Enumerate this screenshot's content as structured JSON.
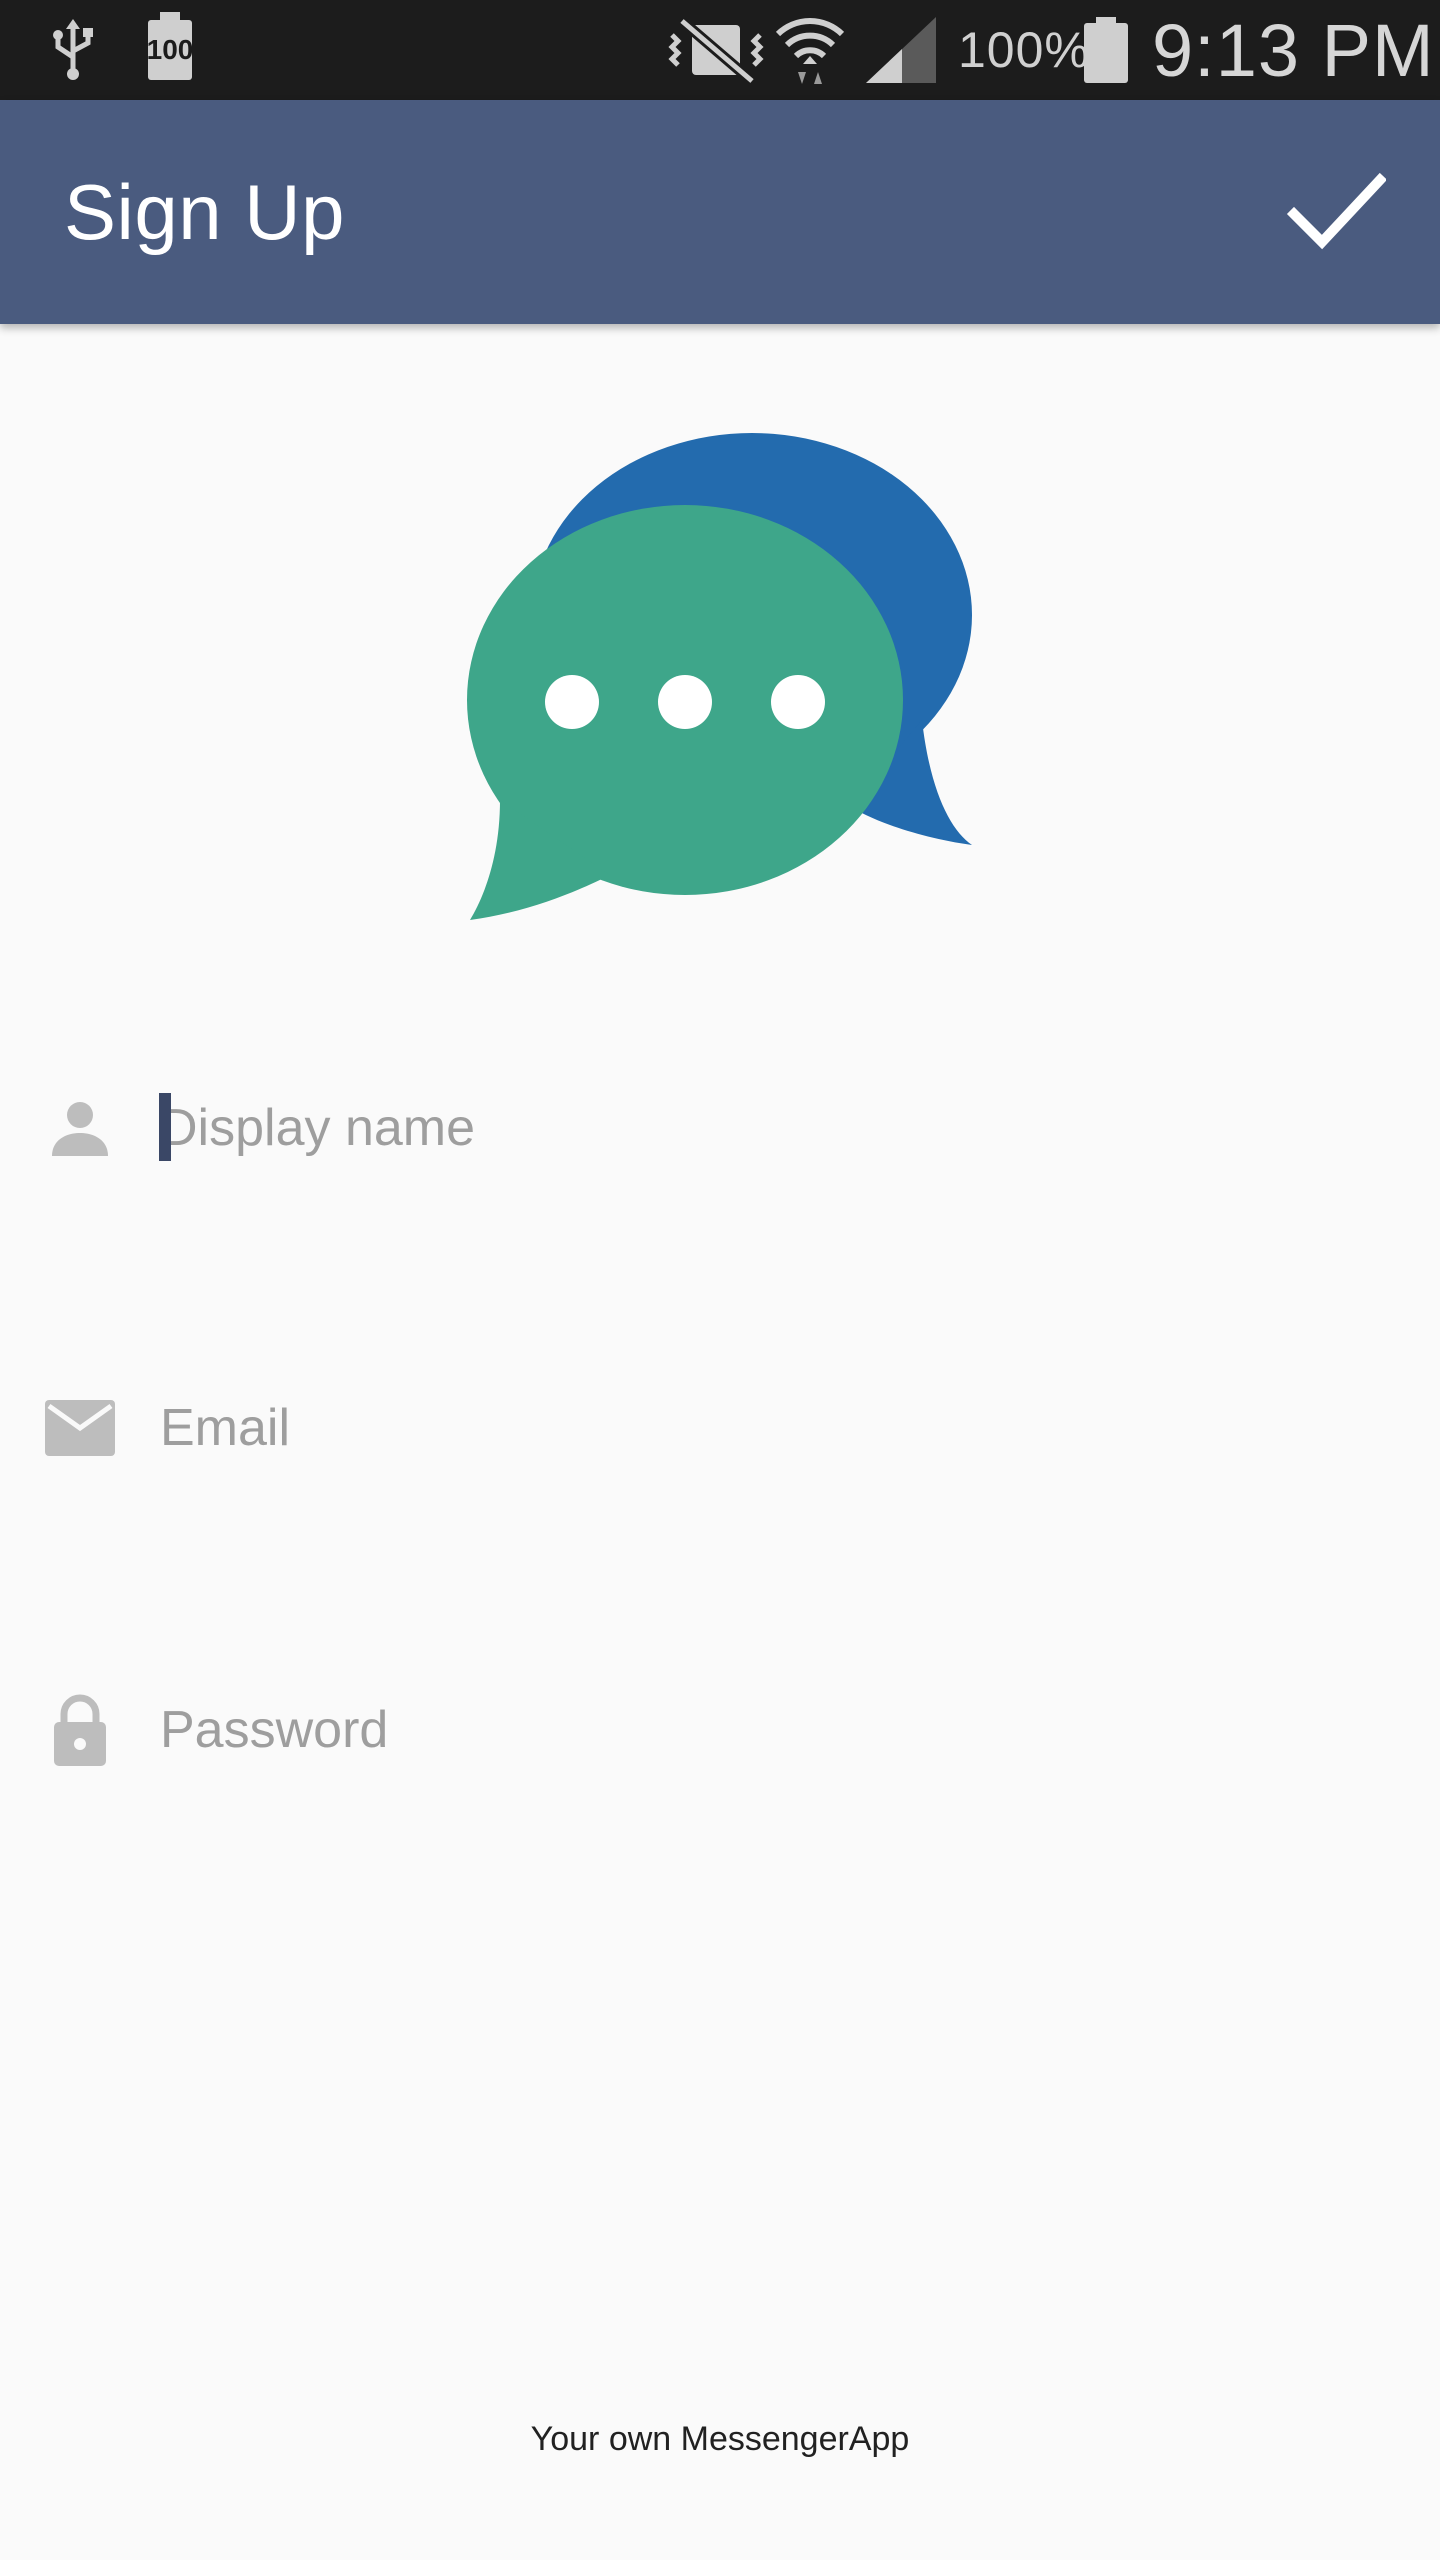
{
  "status_bar": {
    "battery_badge": "100",
    "battery_percent": "100%",
    "time": "9:13 PM",
    "icons": [
      "usb-icon",
      "battery-saver-icon",
      "vibrate-off-icon",
      "wifi-icon",
      "cell-signal-icon",
      "battery-icon"
    ]
  },
  "app_bar": {
    "title": "Sign Up",
    "confirm_icon": "check-icon",
    "background": "#4a5b7f"
  },
  "logo": {
    "icon": "chat-bubbles-logo",
    "colors": {
      "back_bubble": "#236bae",
      "front_bubble": "#3ea68a",
      "dots": "#ffffff"
    }
  },
  "form": {
    "display_name": {
      "placeholder": "Display name",
      "value": "",
      "icon": "person-icon"
    },
    "email": {
      "placeholder": "Email",
      "value": "",
      "icon": "mail-icon"
    },
    "password": {
      "placeholder": "Password",
      "value": "",
      "icon": "lock-icon"
    }
  },
  "footer": {
    "text": "Your own MessengerApp"
  }
}
